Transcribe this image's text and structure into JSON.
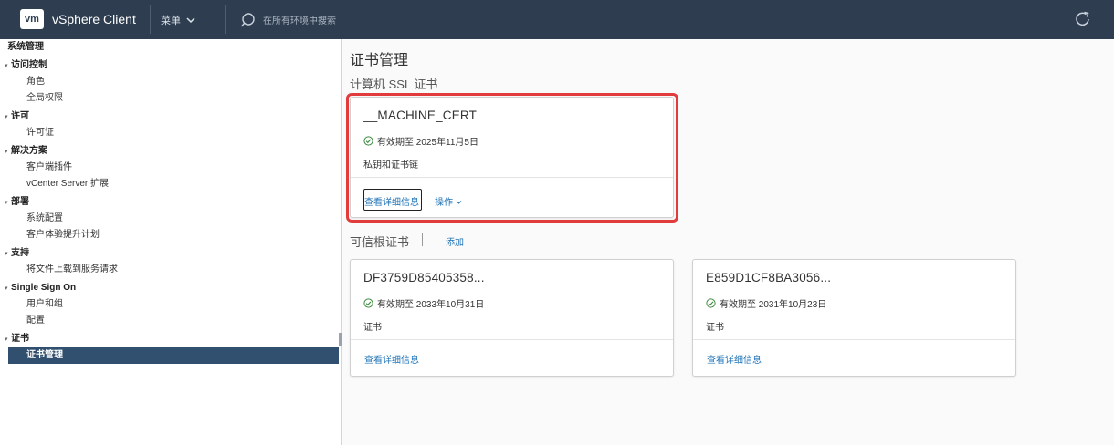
{
  "header": {
    "logo": "vm",
    "app_title": "vSphere Client",
    "menu_label": "菜单",
    "search_placeholder": "在所有环境中搜索",
    "bg_color": "#2e3d4f"
  },
  "sidebar": {
    "root": "系统管理",
    "groups": [
      {
        "label": "访问控制",
        "items": [
          "角色",
          "全局权限"
        ]
      },
      {
        "label": "许可",
        "items": [
          "许可证"
        ]
      },
      {
        "label": "解决方案",
        "items": [
          "客户端插件",
          "vCenter Server 扩展"
        ]
      },
      {
        "label": "部署",
        "items": [
          "系统配置",
          "客户体验提升计划"
        ]
      },
      {
        "label": "支持",
        "items": [
          "将文件上载到服务请求"
        ]
      },
      {
        "label": "Single Sign On",
        "items": [
          "用户和组",
          "配置"
        ]
      },
      {
        "label": "证书",
        "items": [
          "证书管理"
        ]
      }
    ],
    "active_item": "证书管理",
    "active_color": "#31506f"
  },
  "main": {
    "page_title": "证书管理",
    "machine_section": {
      "title": "计算机 SSL 证书",
      "card": {
        "title": "__MACHINE_CERT",
        "valid_text": "有效期至 2025年11月5日",
        "description": "私钥和证书链",
        "view_details": "查看详细信息",
        "actions": "操作"
      }
    },
    "trusted_section": {
      "title": "可信根证书",
      "add_label": "添加",
      "cards": [
        {
          "title": "DF3759D85405358...",
          "valid_text": "有效期至 2033年10月31日",
          "description": "证书",
          "view_details": "查看详细信息"
        },
        {
          "title": "E859D1CF8BA3056...",
          "valid_text": "有效期至 2031年10月23日",
          "description": "证书",
          "view_details": "查看详细信息"
        }
      ]
    },
    "highlight_color": "#e23b3b",
    "link_color": "#1f73b7"
  }
}
